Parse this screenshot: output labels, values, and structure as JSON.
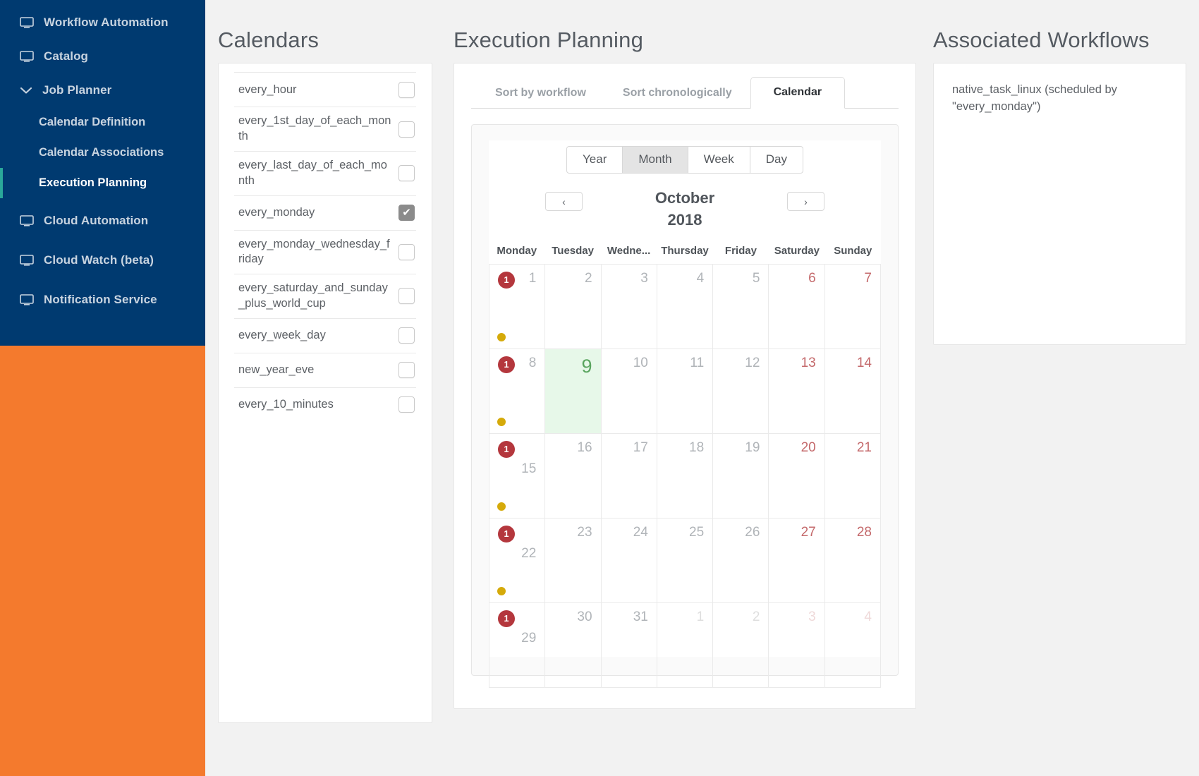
{
  "sidebar": {
    "items": [
      {
        "label": "Workflow Automation",
        "icon": "monitor-icon",
        "type": "top"
      },
      {
        "label": "Catalog",
        "icon": "monitor-icon",
        "type": "top"
      },
      {
        "label": "Job Planner",
        "icon": "chevron-down-icon",
        "type": "group"
      },
      {
        "label": "Calendar Definition",
        "type": "sub",
        "active": false
      },
      {
        "label": "Calendar Associations",
        "type": "sub",
        "active": false
      },
      {
        "label": "Execution Planning",
        "type": "sub",
        "active": true
      },
      {
        "label": "Cloud Automation",
        "icon": "monitor-icon",
        "type": "top"
      },
      {
        "label": "Cloud Watch (beta)",
        "icon": "monitor-icon",
        "type": "top"
      },
      {
        "label": "Notification Service",
        "icon": "monitor-icon",
        "type": "top"
      }
    ],
    "colors": {
      "background": "#003a70",
      "filler": "#f47a2d",
      "active_accent": "#2aa89a"
    }
  },
  "calendars": {
    "title": "Calendars",
    "items": [
      {
        "name": "every_hour",
        "checked": false
      },
      {
        "name": "every_1st_day_of_each_month",
        "checked": false
      },
      {
        "name": "every_last_day_of_each_month",
        "checked": false
      },
      {
        "name": "every_monday",
        "checked": true
      },
      {
        "name": "every_monday_wednesday_friday",
        "checked": false
      },
      {
        "name": "every_saturday_and_sunday_plus_world_cup",
        "checked": false
      },
      {
        "name": "every_week_day",
        "checked": false
      },
      {
        "name": "new_year_eve",
        "checked": false
      },
      {
        "name": "every_10_minutes",
        "checked": false
      }
    ]
  },
  "execution": {
    "title": "Execution Planning",
    "tabs": [
      {
        "label": "Sort by workflow",
        "active": false
      },
      {
        "label": "Sort chronologically",
        "active": false
      },
      {
        "label": "Calendar",
        "active": true
      }
    ],
    "calendar": {
      "views": [
        {
          "label": "Year",
          "active": false
        },
        {
          "label": "Month",
          "active": true
        },
        {
          "label": "Week",
          "active": false
        },
        {
          "label": "Day",
          "active": false
        }
      ],
      "prev_label": "‹",
      "next_label": "›",
      "month": "October",
      "year": "2018",
      "weekdays": [
        "Monday",
        "Tuesday",
        "Wedne...",
        "Thursday",
        "Friday",
        "Saturday",
        "Sunday"
      ],
      "weeks": [
        [
          {
            "day": "1",
            "badge": "1",
            "dot": true,
            "weekend": false,
            "other": false,
            "today": false,
            "wrap": false
          },
          {
            "day": "2",
            "badge": null,
            "dot": false,
            "weekend": false,
            "other": false,
            "today": false,
            "wrap": false
          },
          {
            "day": "3",
            "badge": null,
            "dot": false,
            "weekend": false,
            "other": false,
            "today": false,
            "wrap": false
          },
          {
            "day": "4",
            "badge": null,
            "dot": false,
            "weekend": false,
            "other": false,
            "today": false,
            "wrap": false
          },
          {
            "day": "5",
            "badge": null,
            "dot": false,
            "weekend": false,
            "other": false,
            "today": false,
            "wrap": false
          },
          {
            "day": "6",
            "badge": null,
            "dot": false,
            "weekend": true,
            "other": false,
            "today": false,
            "wrap": false
          },
          {
            "day": "7",
            "badge": null,
            "dot": false,
            "weekend": true,
            "other": false,
            "today": false,
            "wrap": false
          }
        ],
        [
          {
            "day": "8",
            "badge": "1",
            "dot": true,
            "weekend": false,
            "other": false,
            "today": false,
            "wrap": false
          },
          {
            "day": "9",
            "badge": null,
            "dot": false,
            "weekend": false,
            "other": false,
            "today": true,
            "wrap": false
          },
          {
            "day": "10",
            "badge": null,
            "dot": false,
            "weekend": false,
            "other": false,
            "today": false,
            "wrap": false
          },
          {
            "day": "11",
            "badge": null,
            "dot": false,
            "weekend": false,
            "other": false,
            "today": false,
            "wrap": false
          },
          {
            "day": "12",
            "badge": null,
            "dot": false,
            "weekend": false,
            "other": false,
            "today": false,
            "wrap": false
          },
          {
            "day": "13",
            "badge": null,
            "dot": false,
            "weekend": true,
            "other": false,
            "today": false,
            "wrap": false
          },
          {
            "day": "14",
            "badge": null,
            "dot": false,
            "weekend": true,
            "other": false,
            "today": false,
            "wrap": false
          }
        ],
        [
          {
            "day": "15",
            "badge": "1",
            "dot": true,
            "weekend": false,
            "other": false,
            "today": false,
            "wrap": true
          },
          {
            "day": "16",
            "badge": null,
            "dot": false,
            "weekend": false,
            "other": false,
            "today": false,
            "wrap": false
          },
          {
            "day": "17",
            "badge": null,
            "dot": false,
            "weekend": false,
            "other": false,
            "today": false,
            "wrap": false
          },
          {
            "day": "18",
            "badge": null,
            "dot": false,
            "weekend": false,
            "other": false,
            "today": false,
            "wrap": false
          },
          {
            "day": "19",
            "badge": null,
            "dot": false,
            "weekend": false,
            "other": false,
            "today": false,
            "wrap": false
          },
          {
            "day": "20",
            "badge": null,
            "dot": false,
            "weekend": true,
            "other": false,
            "today": false,
            "wrap": false
          },
          {
            "day": "21",
            "badge": null,
            "dot": false,
            "weekend": true,
            "other": false,
            "today": false,
            "wrap": false
          }
        ],
        [
          {
            "day": "22",
            "badge": "1",
            "dot": true,
            "weekend": false,
            "other": false,
            "today": false,
            "wrap": true
          },
          {
            "day": "23",
            "badge": null,
            "dot": false,
            "weekend": false,
            "other": false,
            "today": false,
            "wrap": false
          },
          {
            "day": "24",
            "badge": null,
            "dot": false,
            "weekend": false,
            "other": false,
            "today": false,
            "wrap": false
          },
          {
            "day": "25",
            "badge": null,
            "dot": false,
            "weekend": false,
            "other": false,
            "today": false,
            "wrap": false
          },
          {
            "day": "26",
            "badge": null,
            "dot": false,
            "weekend": false,
            "other": false,
            "today": false,
            "wrap": false
          },
          {
            "day": "27",
            "badge": null,
            "dot": false,
            "weekend": true,
            "other": false,
            "today": false,
            "wrap": false
          },
          {
            "day": "28",
            "badge": null,
            "dot": false,
            "weekend": true,
            "other": false,
            "today": false,
            "wrap": false
          }
        ],
        [
          {
            "day": "29",
            "badge": "1",
            "dot": false,
            "weekend": false,
            "other": false,
            "today": false,
            "wrap": true
          },
          {
            "day": "30",
            "badge": null,
            "dot": false,
            "weekend": false,
            "other": false,
            "today": false,
            "wrap": false
          },
          {
            "day": "31",
            "badge": null,
            "dot": false,
            "weekend": false,
            "other": false,
            "today": false,
            "wrap": false
          },
          {
            "day": "1",
            "badge": null,
            "dot": false,
            "weekend": false,
            "other": true,
            "today": false,
            "wrap": false
          },
          {
            "day": "2",
            "badge": null,
            "dot": false,
            "weekend": false,
            "other": true,
            "today": false,
            "wrap": false
          },
          {
            "day": "3",
            "badge": null,
            "dot": false,
            "weekend": true,
            "other": true,
            "today": false,
            "wrap": false
          },
          {
            "day": "4",
            "badge": null,
            "dot": false,
            "weekend": true,
            "other": true,
            "today": false,
            "wrap": false
          }
        ]
      ],
      "colors": {
        "badge": "#b4373d",
        "dot": "#d5aa0a",
        "today_bg": "#e7f8e9",
        "today_text": "#5aa55f",
        "weekend_text": "#c4696b"
      }
    }
  },
  "associated": {
    "title": "Associated Workflows",
    "items": [
      "native_task_linux (scheduled by \"every_monday\")"
    ]
  }
}
